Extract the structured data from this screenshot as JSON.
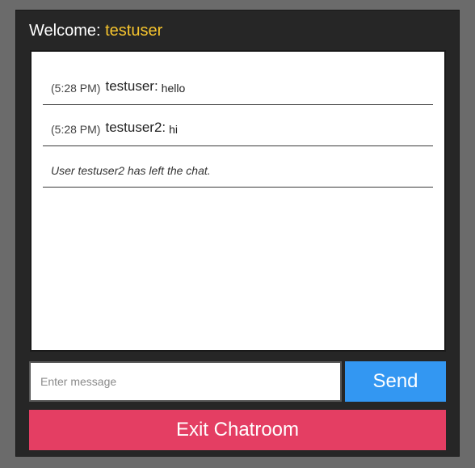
{
  "header": {
    "welcome_label": "Welcome: ",
    "username": "testuser"
  },
  "messages": [
    {
      "time": "(5:28 PM)",
      "sender": "testuser:",
      "text": "hello"
    },
    {
      "time": "(5:28 PM)",
      "sender": "testuser2:",
      "text": "hi"
    }
  ],
  "system_message": "User testuser2 has left the chat.",
  "composer": {
    "placeholder": "Enter message",
    "send_label": "Send"
  },
  "exit_label": "Exit Chatroom",
  "colors": {
    "username_accent": "#f7c52e",
    "send_button": "#3397f2",
    "exit_button": "#e43e63"
  }
}
